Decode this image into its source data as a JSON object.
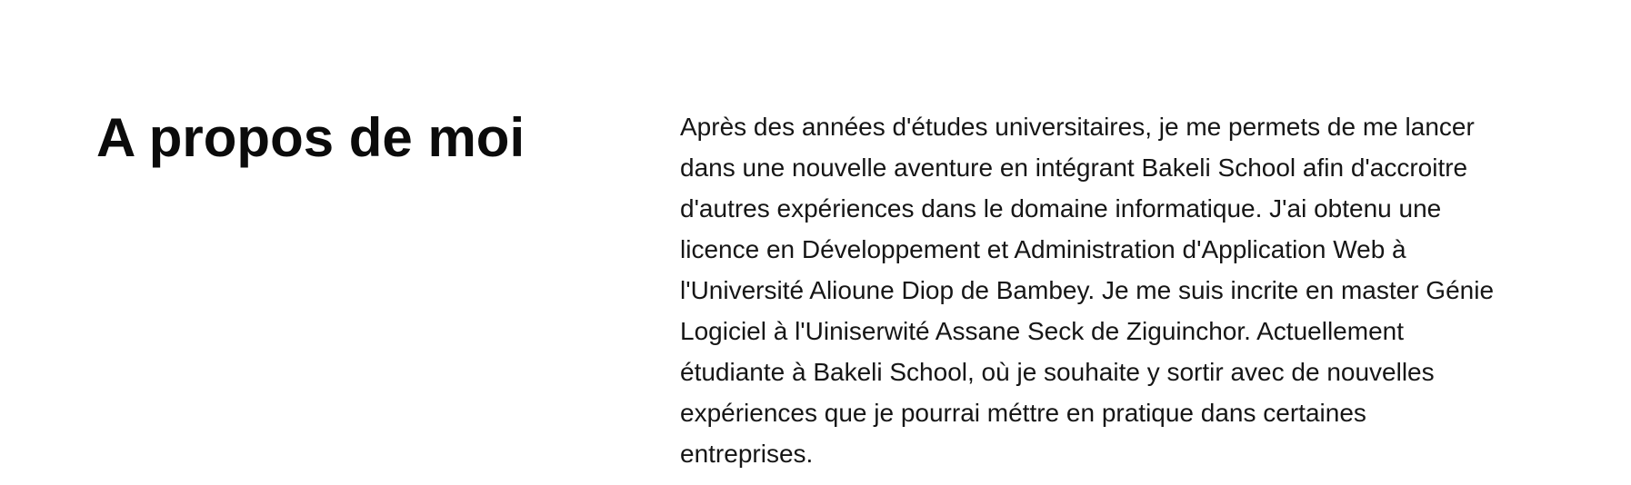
{
  "about": {
    "title": "A propos de moi",
    "paragraph_lines": [
      "Après des années d'études universitaires, je me permets de me lancer",
      "dans une nouvelle aventure en intégrant Bakeli School afin d'accroitre",
      "d'autres expériences dans le domaine informatique. J'ai obtenu une",
      "licence en Développement et Administration d'Application Web à",
      "l'Université Alioune Diop de Bambey. Je me suis incrite en master Génie",
      "Logiciel à l'Uiniserwité Assane Seck de Ziguinchor. Actuellement",
      "étudiante à Bakeli School, où je souhaite y sortir avec de nouvelles",
      "expériences que je pourrai méttre en pratique dans certaines",
      "entreprises."
    ]
  }
}
